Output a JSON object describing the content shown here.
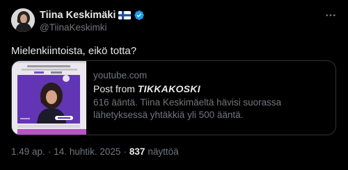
{
  "author": {
    "display_name": "Tiina Keskimäki",
    "handle": "@TiinaKeskimki",
    "flag_icon": "finland-flag-icon",
    "verified_icon": "verified-badge-icon",
    "verified_color": "#1d9bf0"
  },
  "tweet": {
    "text": "Mielenkiintoista, eikö totta?"
  },
  "card": {
    "domain": "youtube.com",
    "title_prefix": "Post from ",
    "title_source": "TIKKAKOSKI",
    "description": "616 ääntä. Tiina Keskimäeltä hävisi suorassa lähetyksessä yhtäkkiä yli 500 ääntä."
  },
  "footer": {
    "time": "1.49 ap.",
    "separator": "·",
    "date": "14. huhtik. 2025",
    "views_count": "837",
    "views_label": "näyttöä"
  },
  "colors": {
    "background": "#000000",
    "text_primary": "#e7e9ea",
    "text_secondary": "#71767b",
    "border": "#2f3336"
  }
}
